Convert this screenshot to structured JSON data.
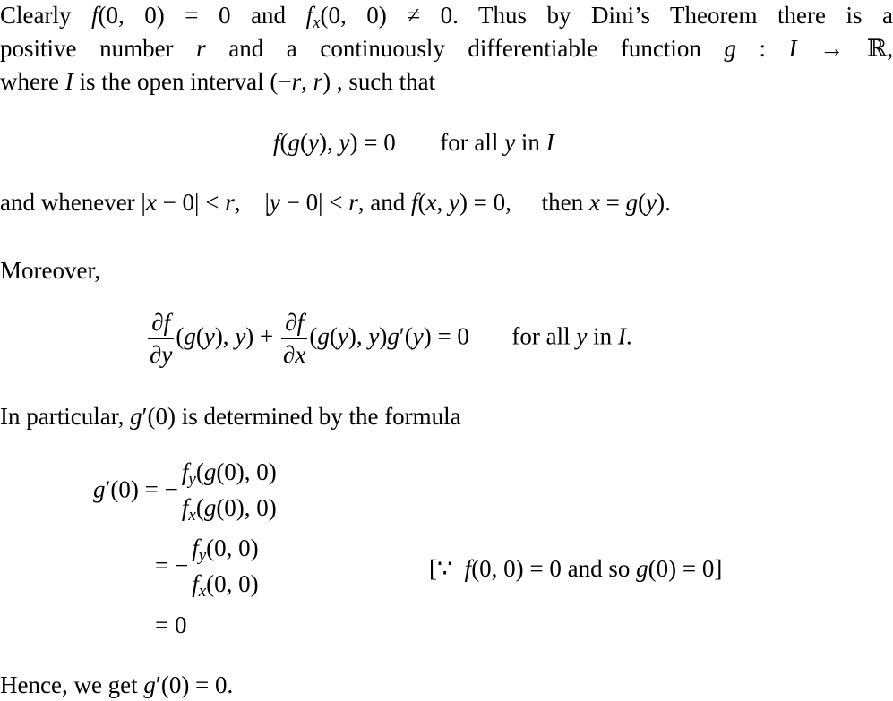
{
  "paragraph1": {
    "line1": "Clearly f(0,0) = 0 and f_x(0,0) ≠ 0.  Thus by Dini's Theorem there is a",
    "line2": "positive number r and a continuously differentiable function g : I → ℝ,",
    "line3": "where I is the open interval (−r, r), such that"
  },
  "equation1": {
    "lhs": "f(g(y), y) = 0",
    "condition": "for all y in I"
  },
  "paragraph2": {
    "text": "and whenever |x − 0| < r,    |y − 0| < r, and f(x, y) = 0,     then x = g(y)."
  },
  "paragraph3": {
    "text": "Moreover,"
  },
  "equation2": {
    "frac1_num": "∂f",
    "frac1_den": "∂y",
    "middle": "(g(y), y) +",
    "frac2_num": "∂f",
    "frac2_den": "∂x",
    "tail": "(g(y), y)g′(y) = 0",
    "condition": "for all y in I."
  },
  "paragraph4": {
    "text": "In particular, g′(0) is determined by the formula"
  },
  "derivation": {
    "lhs": "g′(0)",
    "step1": {
      "prefix": "= −",
      "num": "f_y(g(0), 0)",
      "den": "f_x(g(0), 0)"
    },
    "step2": {
      "prefix": "= −",
      "num": "f_y(0, 0)",
      "den": "f_x(0, 0)",
      "reason": "[∵  f(0, 0) = 0 and so g(0) = 0]"
    },
    "step3": {
      "prefix": "= 0"
    }
  },
  "conclusion": {
    "text": "Hence, we get g′(0) = 0."
  }
}
